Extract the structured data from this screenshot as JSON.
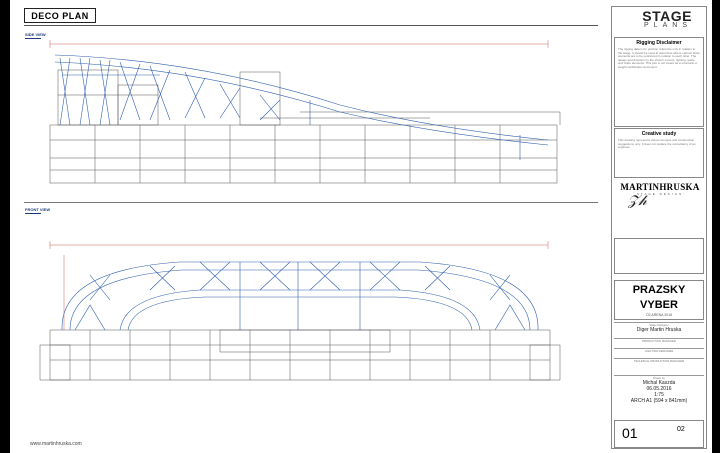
{
  "header": {
    "title": "DECO PLAN"
  },
  "views": {
    "side": "SIDE VIEW",
    "front": "FRONT VIEW"
  },
  "footer": {
    "url": "www.martinhruska.com"
  },
  "brand": {
    "line1": "STAGE",
    "line2": "PLANS"
  },
  "rigging": {
    "title": "Rigging Disclaimer",
    "body": "The rigging data is for position reference only in relation to the stage. It should be used to determine where various show elements are to be positioned in relation to each other. The design and direction by the show's movers, lighting, audio and video elements. This plot is not meant as a structural or weight certification document."
  },
  "creative": {
    "title": "Creative study",
    "body": "This drawing represents visual concepts and construction suggestions only. It does not replace the consultancy of an engineer."
  },
  "designer": {
    "name": "MARTINHRUSKA",
    "sub": "STAGE DESIGN"
  },
  "project": {
    "name1": "PRAZSKY",
    "name2": "VYBER",
    "venue": "O2 ARENA 2016"
  },
  "fields": {
    "designer_label": "Stage Designer",
    "designer_value": "Diger Martin Hruska",
    "drawn_label": "Drawn by",
    "drawn_value": "Michal Kaszda",
    "date_value": "06.05.2016",
    "scale_value": "1:75",
    "size_value": "ARCH A1 (594 x 841mm)",
    "small1": "PRODUCTION MANAGER",
    "small2": "LIGHTING DESIGNER",
    "small3": "TECHNICAL PRODUCTION MANAGER"
  },
  "sheet": {
    "number": "01",
    "total": "02"
  },
  "colors": {
    "structure": "#2f5fae",
    "outline": "#555555",
    "dimension": "#c0392b"
  }
}
